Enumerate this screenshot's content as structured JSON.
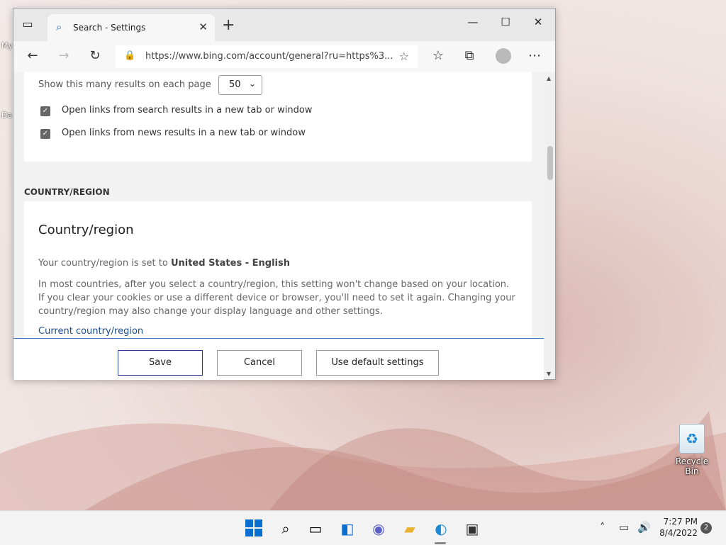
{
  "desktop": {
    "recycle_bin_label": "Recycle Bin",
    "left_icon_labels": [
      "My",
      "Da"
    ]
  },
  "browser": {
    "tab_title": "Search - Settings",
    "address_url": "https://www.bing.com/account/general?ru=https%3...",
    "icons": {
      "tab_actions": "tab-actions-icon",
      "search": "search-icon",
      "close_tab": "close-icon",
      "new_tab": "plus-icon",
      "minimize": "minimize-icon",
      "maximize": "maximize-icon",
      "close_window": "close-icon",
      "back": "back-arrow-icon",
      "forward": "forward-arrow-icon",
      "refresh": "refresh-icon",
      "lock": "lock-icon",
      "add_favorite": "star-plus-icon",
      "favorites": "favorites-icon",
      "collections": "collections-icon",
      "profile": "profile-icon",
      "more": "more-icon"
    }
  },
  "page": {
    "results_per_page_label": "Show this many results on each page",
    "results_per_page_value": "50",
    "option_links_search": "Open links from search results in a new tab or window",
    "option_links_news": "Open links from news results in a new tab or window",
    "section_heading": "COUNTRY/REGION",
    "card_title": "Country/region",
    "set_prefix": "Your country/region is set to ",
    "set_value": "United States - English",
    "description": "In most countries, after you select a country/region, this setting won't change based on your location. If you clear your cookies or use a different device or browser, you'll need to set it again. Changing your country/region may also change your display language and other settings.",
    "current_link": "Current country/region"
  },
  "footer": {
    "save": "Save",
    "cancel": "Cancel",
    "defaults": "Use default settings"
  },
  "taskbar": {
    "time": "7:27 PM",
    "date": "8/4/2022",
    "notification_count": "2",
    "colors": {
      "start": "#0a6ed1",
      "accent_link": "#1a4d8f"
    }
  }
}
